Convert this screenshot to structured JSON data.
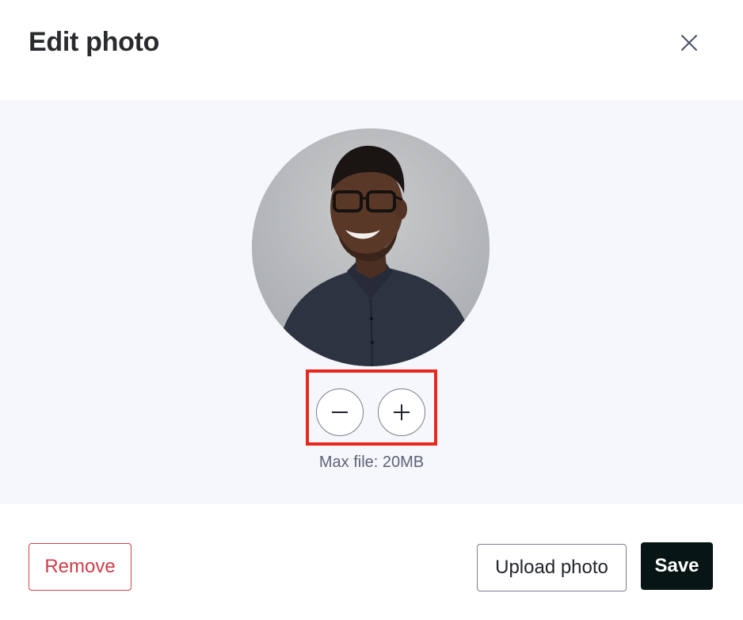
{
  "dialog": {
    "title": "Edit photo",
    "close_icon": "close-icon"
  },
  "editor": {
    "photo_alt": "Profile photo preview",
    "zoom_out_icon": "minus-icon",
    "zoom_in_icon": "plus-icon",
    "max_file_text": "Max file: 20MB"
  },
  "footer": {
    "remove_label": "Remove",
    "upload_label": "Upload photo",
    "save_label": "Save"
  },
  "colors": {
    "editor_background": "#f6f7fc",
    "remove_text": "#cf3d48",
    "save_background": "#071615",
    "highlight_border": "#e8281c"
  }
}
